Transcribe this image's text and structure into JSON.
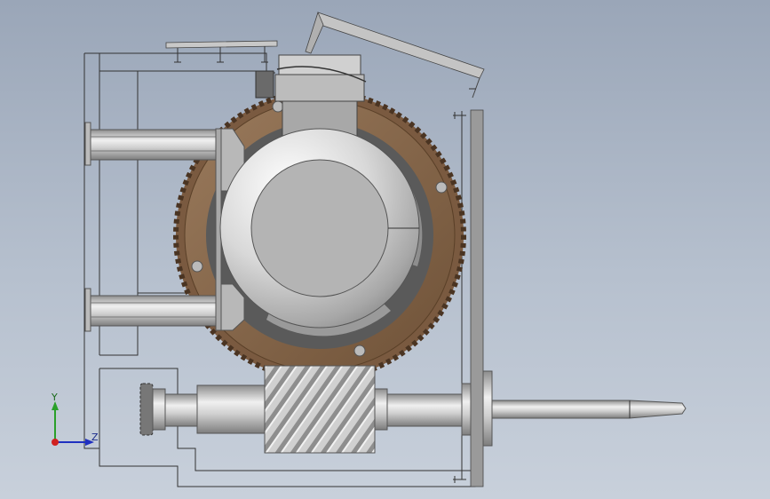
{
  "triad": {
    "y_label": "Y",
    "z_label": "Z"
  },
  "colors": {
    "background_top": "#9aa6b8",
    "background_bottom": "#c8d0db",
    "gear_bronze": "#8a6a4c",
    "steel": "#c9c9c9",
    "y_axis": "#2aa02a",
    "z_axis": "#2030c0",
    "origin": "#d02020"
  }
}
